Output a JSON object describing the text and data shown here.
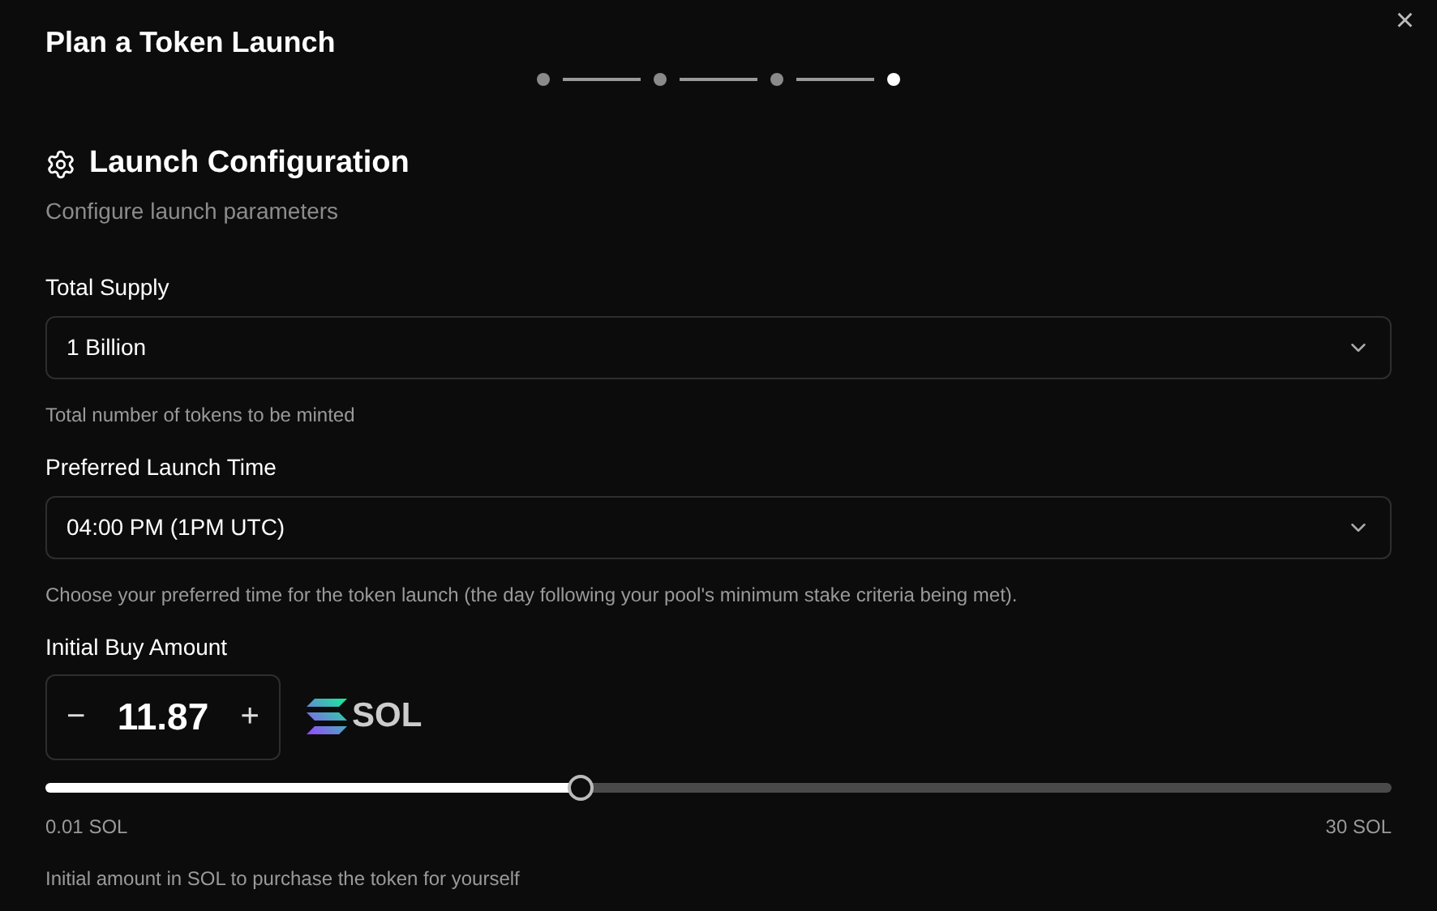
{
  "dialog": {
    "title": "Plan a Token Launch",
    "close": "×"
  },
  "steps": [
    {
      "selected": false
    },
    {
      "selected": false
    },
    {
      "selected": false
    },
    {
      "selected": true
    }
  ],
  "section": {
    "title": "Launch Configuration",
    "description": "Configure launch parameters"
  },
  "fields": [
    {
      "label": "Total Supply",
      "value": "1 Billion",
      "help": "Total number of tokens to be minted"
    },
    {
      "label": "Preferred Launch Time",
      "value": "04:00 PM (1PM UTC)",
      "help": "Choose your preferred time for the token launch (the day following your pool's minimum stake criteria being met)."
    }
  ],
  "initial_buy": {
    "label": "Initial Buy Amount",
    "minus": "−",
    "value": "11.87",
    "plus": "+",
    "currency": "SOL",
    "level": 0.398,
    "min_label": "0.01 SOL",
    "max_label": "30 SOL",
    "help": "Initial amount in SOL to purchase the token for yourself"
  }
}
